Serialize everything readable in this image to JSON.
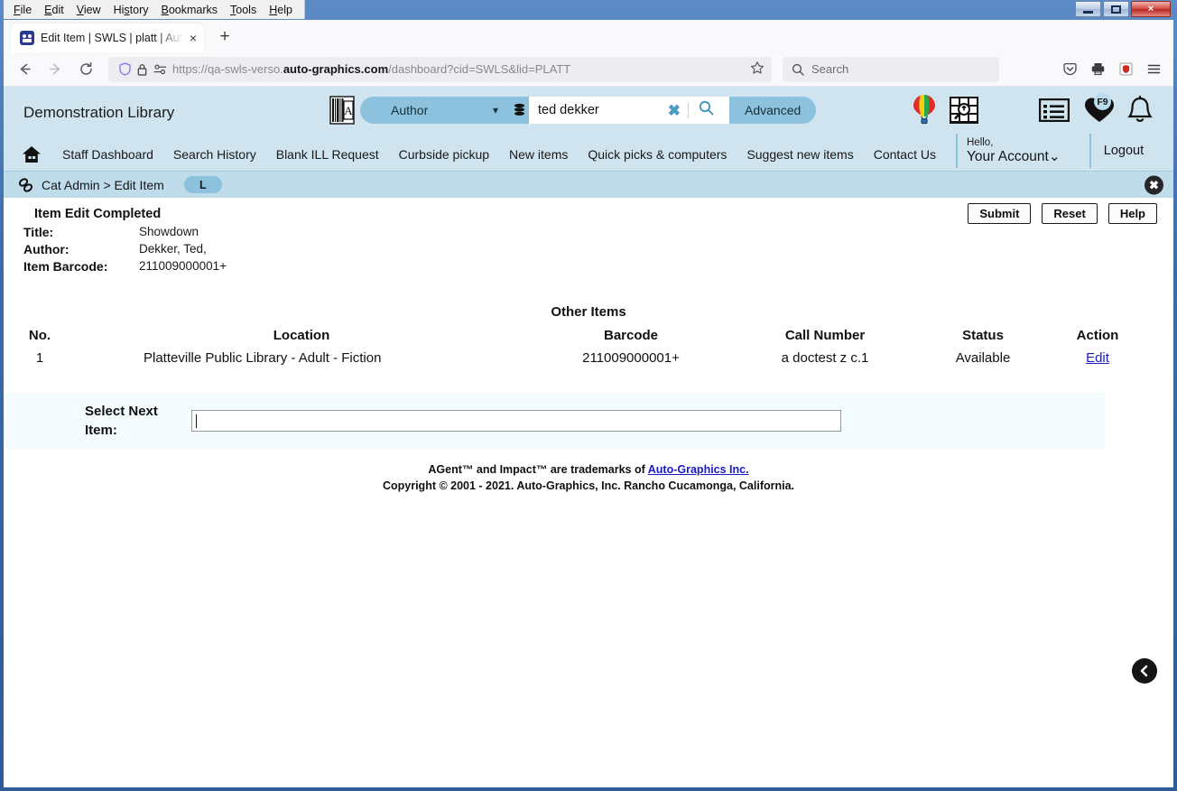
{
  "os": {
    "menu": [
      "File",
      "Edit",
      "View",
      "History",
      "Bookmarks",
      "Tools",
      "Help"
    ],
    "window_title": "",
    "controls": {
      "minimize": "",
      "maximize": "",
      "close": "×"
    }
  },
  "browser": {
    "tab": {
      "title": "Edit Item | SWLS | platt | Auto-G",
      "close": "×"
    },
    "new_tab": "+",
    "nav": {
      "back": "←",
      "forward": "→",
      "reload": "⟳"
    },
    "url": {
      "scheme": "https://qa-swls-verso.",
      "domain": "auto-graphics.com",
      "path": "/dashboard?cid=SWLS&lid=PLATT"
    },
    "search": {
      "placeholder": "Search"
    }
  },
  "app": {
    "library_name": "Demonstration Library",
    "search": {
      "scope_selected": "Author",
      "query": "ted dekker",
      "clear_label": "✖",
      "advanced_label": "Advanced"
    },
    "account": {
      "hello": "Hello,",
      "name": "Your Account",
      "caret": "˅"
    },
    "logout": "Logout",
    "favorites_badge": "F9",
    "nav_items": [
      "Staff Dashboard",
      "Search History",
      "Blank ILL Request",
      "Curbside pickup",
      "New items",
      "Quick picks & computers",
      "Suggest new items",
      "Contact Us"
    ],
    "breadcrumb": {
      "text": "Cat Admin > Edit Item",
      "pill": "L",
      "close": "✖"
    }
  },
  "main": {
    "heading": "Item Edit Completed",
    "buttons": {
      "submit": "Submit",
      "reset": "Reset",
      "help": "Help"
    },
    "meta": [
      {
        "label": "Title:",
        "value": "Showdown"
      },
      {
        "label": "Author:",
        "value": "Dekker, Ted,"
      },
      {
        "label": "Item Barcode:",
        "value": "211009000001+"
      }
    ],
    "other_items_title": "Other Items",
    "table": {
      "headers": [
        "No.",
        "Location",
        "Barcode",
        "Call Number",
        "Status",
        "Action"
      ],
      "rows": [
        {
          "no": "1",
          "location": "Platteville Public Library - Adult - Fiction",
          "barcode": "211009000001+",
          "call_number": "a doctest z   c.1",
          "status": "Available",
          "action": "Edit"
        }
      ]
    },
    "select_next": {
      "label": "Select Next Item:",
      "value": "",
      "placeholder": ""
    }
  },
  "footer": {
    "line1_pre": "AGent™ and Impact™ are trademarks of ",
    "line1_link": "Auto-Graphics Inc.",
    "line2": "Copyright © 2001 - 2021. Auto-Graphics, Inc. Rancho Cucamonga, California."
  },
  "colors": {
    "header_bg": "#cfe4ef",
    "accent": "#8cc2dd",
    "crumb_bg": "#bfdcea",
    "link": "#1a1acc",
    "next_row_bg": "#f5fcff"
  }
}
